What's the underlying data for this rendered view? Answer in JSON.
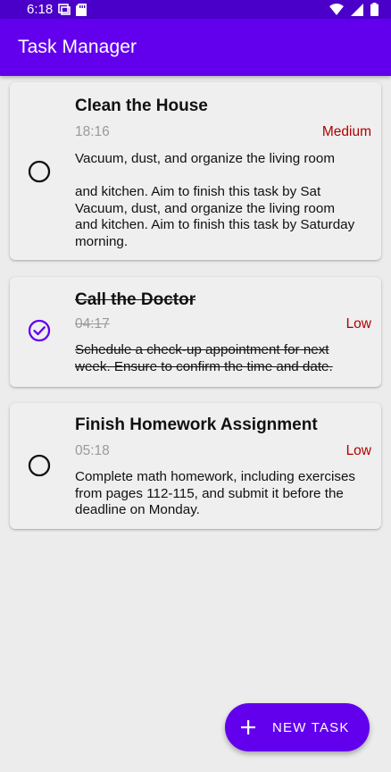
{
  "status_bar": {
    "time": "6:18",
    "icons": [
      "screen-icon",
      "sd-card-icon",
      "wifi-icon",
      "signal-icon",
      "battery-icon"
    ]
  },
  "app_bar": {
    "title": "Task Manager"
  },
  "tasks": [
    {
      "title": "Clean the House",
      "time": "18:16",
      "priority": "Medium",
      "completed": false,
      "description": "Vacuum, dust, and organize the living room\n\n and kitchen. Aim to finish this task by Sat\nVacuum, dust, and organize the living room\nand kitchen. Aim to finish this task by Saturday\nmorning."
    },
    {
      "title": "Call the Doctor",
      "time": "04:17",
      "priority": "Low",
      "completed": true,
      "description": " Schedule a check-up appointment for next\nweek. Ensure to confirm the time and date."
    },
    {
      "title": "Finish Homework Assignment",
      "time": "05:18",
      "priority": "Low",
      "completed": false,
      "description": "Complete math homework, including exercises\nfrom pages 112-115, and submit it before the\ndeadline on Monday."
    }
  ],
  "fab": {
    "label": "NEW TASK",
    "icon": "plus-icon"
  },
  "colors": {
    "primary": "#6200ee",
    "status_bar": "#4b00c9",
    "priority": "#b00000",
    "check_done": "#6200ee"
  }
}
